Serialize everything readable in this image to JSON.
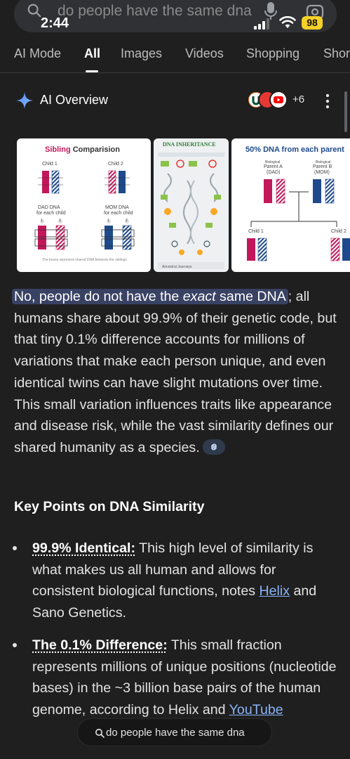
{
  "status": {
    "time": "2:44",
    "battery": "98"
  },
  "search": {
    "query": "do people have the same dna"
  },
  "tabs": [
    "AI Mode",
    "All",
    "Images",
    "Videos",
    "Shopping",
    "Shor"
  ],
  "overview": {
    "title": "AI Overview",
    "source_count": "+6"
  },
  "images": {
    "card1": {
      "title_colored": "Sibling",
      "title_rest": " Comparision",
      "child1": "Child 1",
      "child2": "Child 2",
      "dad_dna": "DAD DNA",
      "mom_dna": "MOM DNA",
      "each_child_1": "for each child",
      "each_child_2": "for each child",
      "num1": "1",
      "num2": "2",
      "num3": "1",
      "num4": "2",
      "caption": "The boxes represent shared DNA between the siblings"
    },
    "card2": {
      "title": "DNA INHERITANCE",
      "footer": "Ancestral Journeys"
    },
    "card3": {
      "title": "50% DNA from each parent",
      "bio_a": "Biological",
      "parent_a": "Parent A",
      "dad": "(DAD)",
      "bio_b": "Biological",
      "parent_b": "Parent B",
      "mom": "(MOM)",
      "child1": "Child 1",
      "child2": "Child 2"
    }
  },
  "answer": {
    "highlight_pre": "No, people do not have the ",
    "highlight_em": "exact",
    "highlight_post": " same DNA",
    "rest": "; all humans share about 99.9% of their genetic code, but that tiny 0.1% difference accounts for millions of variations that make each person unique, and even identical twins can have slight mutations over time. This small variation influences traits like appearance and disease risk, while the vast similarity defines our shared humanity as a species."
  },
  "key_points": {
    "heading": "Key Points on DNA Similarity",
    "items": [
      {
        "term": "99.9% Identical:",
        "text_before": " This high level of similarity is what makes us all human and allows for consistent biological functions, notes ",
        "link": "Helix",
        "text_after": " and Sano Genetics."
      },
      {
        "term": "The 0.1% Difference:",
        "text_before": " This small fraction represents millions of unique positions (nucleotide bases) in the ~3 billion base pairs of the human genome, according to Helix and ",
        "link": "YouTube",
        "text_after": ""
      }
    ]
  },
  "floating_search": {
    "text": "do people have the same dna"
  }
}
